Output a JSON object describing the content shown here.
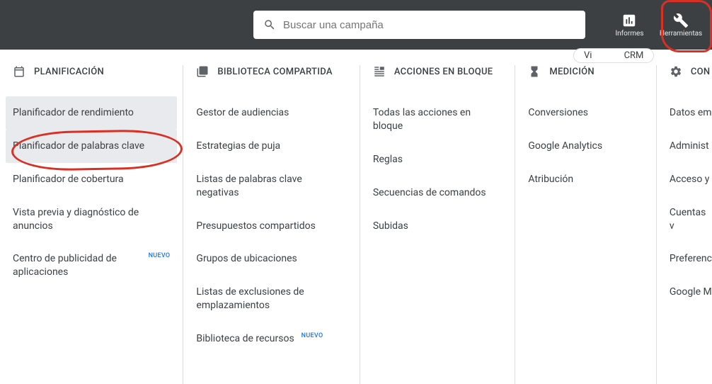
{
  "header": {
    "search_placeholder": "Buscar una campaña",
    "informes": "Informes",
    "herramientas": "Herramientas"
  },
  "badge_new": "NUEVO",
  "columns": {
    "planificacion": {
      "title": "PLANIFICACIÓN",
      "items": {
        "rendimiento": "Planificador de rendimiento",
        "palabras": "Planificador de palabras clave",
        "cobertura": "Planificador de cobertura",
        "vista_previa": "Vista previa y diagnóstico de anuncios",
        "publicidad_apps": "Centro de publicidad de aplicaciones"
      }
    },
    "biblioteca": {
      "title": "BIBLIOTECA COMPARTIDA",
      "items": {
        "audiencias": "Gestor de audiencias",
        "estrategias": "Estrategias de puja",
        "listas_neg": "Listas de palabras clave negativas",
        "presupuestos": "Presupuestos compartidos",
        "grupos_ubic": "Grupos de ubicaciones",
        "listas_excl": "Listas de exclusiones de emplazamientos",
        "recursos": "Biblioteca de recursos"
      }
    },
    "acciones": {
      "title": "ACCIONES EN BLOQUE",
      "items": {
        "todas": "Todas las acciones en bloque",
        "reglas": "Reglas",
        "secuencias": "Secuencias de comandos",
        "subidas": "Subidas"
      }
    },
    "medicion": {
      "title": "MEDICIÓN",
      "items": {
        "conversiones": "Conversiones",
        "analytics": "Google Analytics",
        "atribucion": "Atribución"
      }
    },
    "configuracion": {
      "title": "CON",
      "items": {
        "datos": "Datos em",
        "administ": "Administ",
        "acceso": "Acceso y",
        "cuentas": "Cuentas v",
        "preferenc": "Preferenc",
        "googlem": "Google M"
      }
    }
  }
}
